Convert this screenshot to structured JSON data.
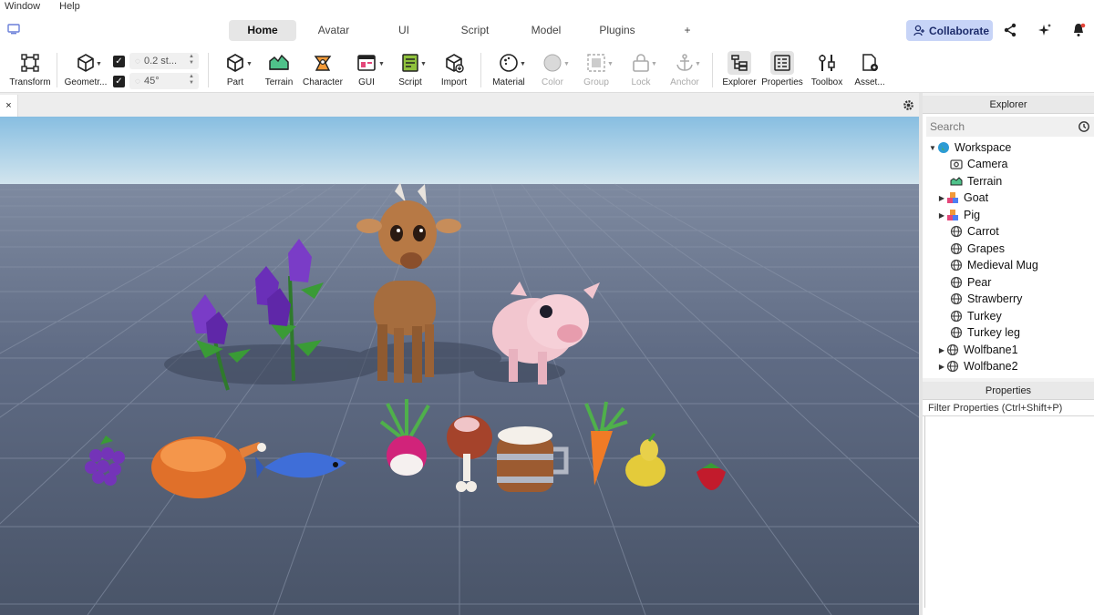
{
  "menu": [
    "Window",
    "Help"
  ],
  "tabs": [
    {
      "label": "Home",
      "active": true
    },
    {
      "label": "Avatar"
    },
    {
      "label": "UI"
    },
    {
      "label": "Script"
    },
    {
      "label": "Model"
    },
    {
      "label": "Plugins"
    },
    {
      "label": "+"
    }
  ],
  "collaborate_label": "Collaborate",
  "tools": {
    "transform": "Transform",
    "geometry": "Geometr...",
    "move_snap": "0.2 st...",
    "rotate_snap": "45°",
    "part": "Part",
    "terrain": "Terrain",
    "character": "Character",
    "gui": "GUI",
    "script": "Script",
    "import": "Import",
    "material": "Material",
    "color": "Color",
    "group": "Group",
    "lock": "Lock",
    "anchor": "Anchor",
    "explorer": "Explorer",
    "properties": "Properties",
    "toolbox": "Toolbox",
    "assets": "Asset..."
  },
  "viewport_tab_close": "×",
  "explorer": {
    "title": "Explorer",
    "search_placeholder": "Search",
    "items": [
      {
        "label": "Workspace",
        "icon": "globe-icon",
        "expanded": true
      },
      {
        "label": "Camera",
        "icon": "camera-icon"
      },
      {
        "label": "Terrain",
        "icon": "terrain-icon"
      },
      {
        "label": "Goat",
        "icon": "model-icon",
        "collapsed": true
      },
      {
        "label": "Pig",
        "icon": "model-icon",
        "collapsed": true
      },
      {
        "label": "Carrot",
        "icon": "mesh-icon"
      },
      {
        "label": "Grapes",
        "icon": "mesh-icon"
      },
      {
        "label": "Medieval Mug",
        "icon": "mesh-icon"
      },
      {
        "label": "Pear",
        "icon": "mesh-icon"
      },
      {
        "label": "Strawberry",
        "icon": "mesh-icon"
      },
      {
        "label": "Turkey",
        "icon": "mesh-icon"
      },
      {
        "label": "Turkey leg",
        "icon": "mesh-icon"
      },
      {
        "label": "Wolfbane1",
        "icon": "mesh-icon",
        "collapsed": true
      },
      {
        "label": "Wolfbane2",
        "icon": "mesh-icon",
        "collapsed": true
      }
    ]
  },
  "properties": {
    "title": "Properties",
    "filter_placeholder": "Filter Properties (Ctrl+Shift+P)"
  },
  "colors": {
    "accent": "#c7d4f7",
    "sky_top": "#8ec3e3",
    "ground": "#5f6b83"
  }
}
